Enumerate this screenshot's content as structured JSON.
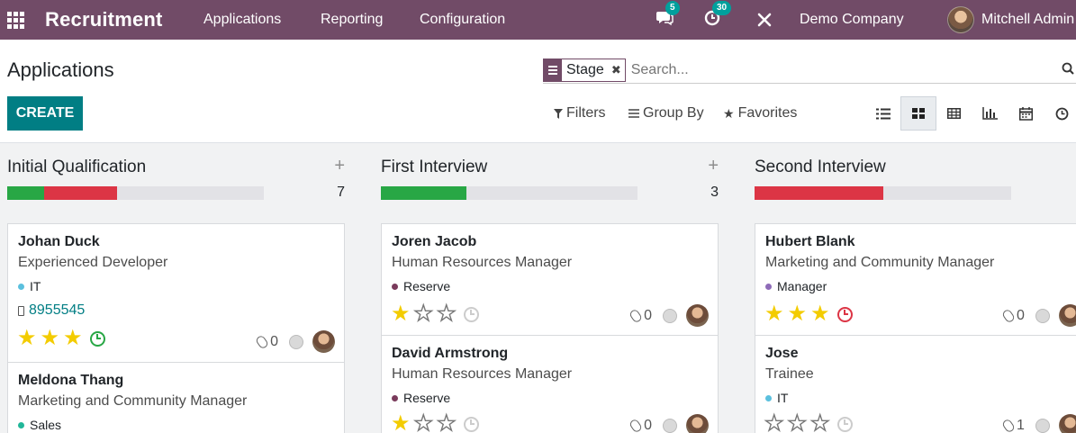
{
  "navbar": {
    "app_title": "Recruitment",
    "menu": [
      "Applications",
      "Reporting",
      "Configuration"
    ],
    "messages_count": "5",
    "activities_count": "30",
    "company": "Demo Company",
    "user": "Mitchell Admin"
  },
  "control": {
    "page_title": "Applications",
    "create_label": "CREATE",
    "facet_value": "Stage",
    "facet_remove": "✖",
    "search_placeholder": "Search...",
    "filters_label": "Filters",
    "groupby_label": "Group By",
    "favorites_label": "Favorites"
  },
  "columns": [
    {
      "title": "Initial Qualification",
      "count": "7",
      "progress": [
        {
          "fraction": 0.143,
          "color": "#28a745"
        },
        {
          "fraction": 0.286,
          "color": "#dc3545"
        }
      ],
      "cards": [
        {
          "name": "Johan Duck",
          "job": "Experienced Developer",
          "tag": "IT",
          "tag_color": "#5bc0de",
          "phone": "8955545",
          "stars": 3,
          "clock": "green",
          "attachments": "0"
        },
        {
          "name": "Meldona Thang",
          "job": "Marketing and Community Manager",
          "tag": "Sales",
          "tag_color": "#21b799"
        }
      ]
    },
    {
      "title": "First Interview",
      "count": "3",
      "progress": [
        {
          "fraction": 0.333,
          "color": "#28a745"
        }
      ],
      "cards": [
        {
          "name": "Joren Jacob",
          "job": "Human Resources Manager",
          "tag": "Reserve",
          "tag_color": "#7a3b5c",
          "stars": 1,
          "clock": "grey",
          "attachments": "0"
        },
        {
          "name": "David Armstrong",
          "job": "Human Resources Manager",
          "tag": "Reserve",
          "tag_color": "#7a3b5c",
          "stars": 1,
          "clock": "grey",
          "attachments": "0"
        }
      ]
    },
    {
      "title": "Second Interview",
      "count": "",
      "progress": [
        {
          "fraction": 0.5,
          "color": "#dc3545"
        }
      ],
      "cards": [
        {
          "name": "Hubert Blank",
          "job": "Marketing and Community Manager",
          "tag": "Manager",
          "tag_color": "#8e6bb8",
          "stars": 3,
          "clock": "red",
          "attachments": "0"
        },
        {
          "name": "Jose",
          "job": "Trainee",
          "tag": "IT",
          "tag_color": "#5bc0de",
          "stars": 0,
          "clock": "grey",
          "attachments": "1"
        }
      ]
    }
  ],
  "colors": {
    "brand": "#714B67",
    "primary_button": "#017E84",
    "star": "#F3CC00"
  }
}
